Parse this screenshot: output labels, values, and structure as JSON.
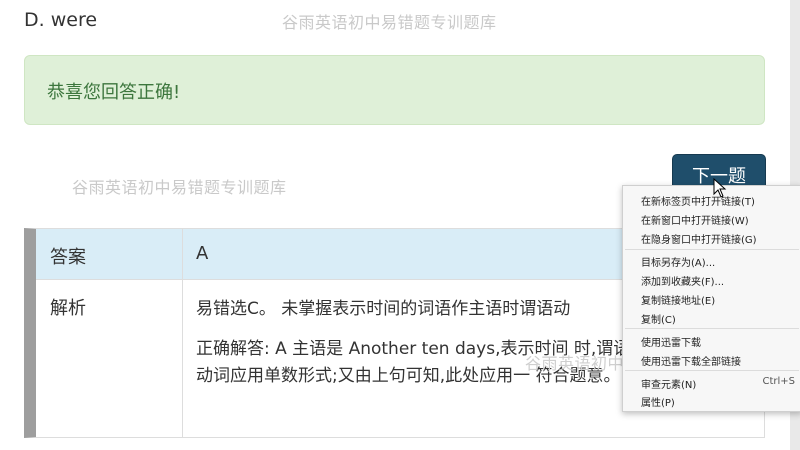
{
  "question": {
    "option_d": "D. were"
  },
  "watermark": "谷雨英语初中易错题专训题库",
  "alert": {
    "message": "恭喜您回答正确!"
  },
  "next_button": {
    "label": "下一题"
  },
  "answer_table": {
    "answer_label": "答案",
    "answer_value": "A",
    "analysis_label": "解析",
    "analysis_line1": "易错选C。  未掌握表示时间的词语作主语时谓语动",
    "analysis_para": "正确解答: A  主语是 Another ten days,表示时间 时,谓语动词应用单数形式;又由上句可知,此处应用一 符合题意。"
  },
  "context_menu": {
    "items": [
      "在新标签页中打开链接(T)",
      "在新窗口中打开链接(W)",
      "在隐身窗口中打开链接(G)",
      "目标另存为(A)...",
      "添加到收藏夹(F)...",
      "复制链接地址(E)",
      "复制(C)",
      "使用迅雷下载",
      "使用迅雷下载全部链接",
      "审查元素(N)",
      "属性(P)"
    ],
    "inspect_shortcut": "Ctrl+S"
  },
  "colors": {
    "success_bg": "#dff0d8",
    "success_text": "#3c763d",
    "button_bg": "#1f4e6b",
    "answer_row_bg": "#d9edf7"
  }
}
